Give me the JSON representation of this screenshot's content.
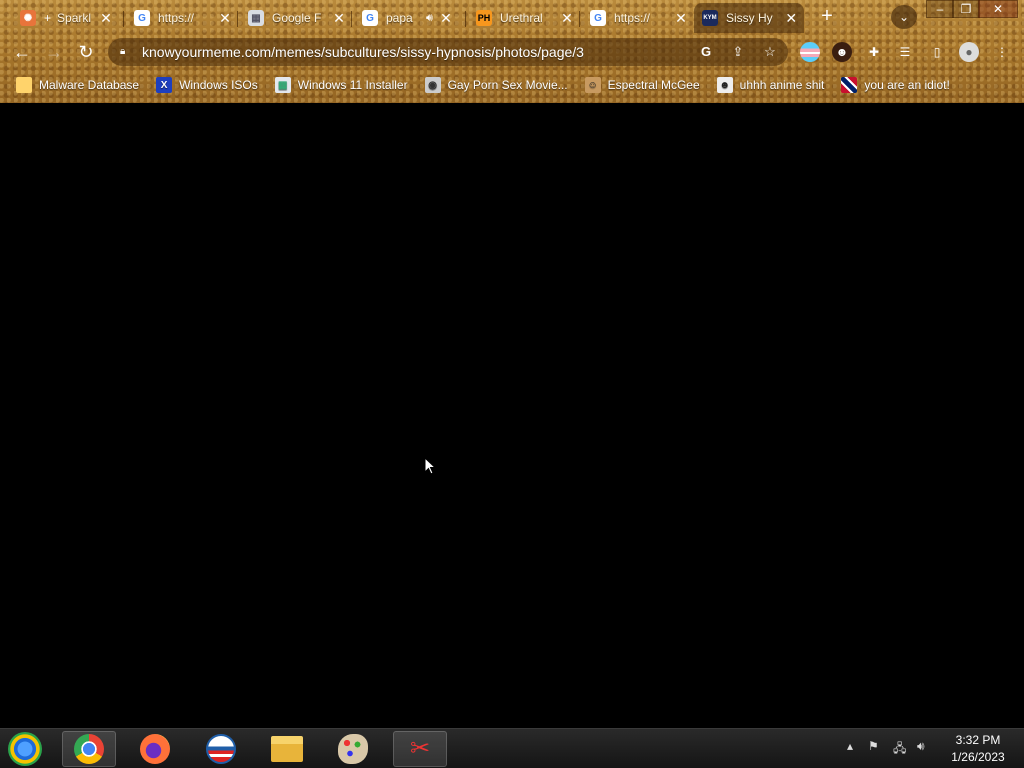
{
  "tabs": [
    {
      "title": "Sparkl",
      "prefix": "+",
      "favicon": "sparkle-icon",
      "active": false
    },
    {
      "title": "https://",
      "favicon": "google-icon",
      "active": false
    },
    {
      "title": "Google F",
      "favicon": "image-icon",
      "active": false
    },
    {
      "title": "papa",
      "favicon": "google-icon",
      "audio": true,
      "active": false
    },
    {
      "title": "Urethral",
      "favicon": "ph-icon",
      "favicon_text": "PH",
      "active": false
    },
    {
      "title": "https://",
      "favicon": "google-icon",
      "active": false
    },
    {
      "title": "Sissy Hy",
      "favicon": "kym-icon",
      "active": true
    }
  ],
  "address_bar": {
    "url": "knowyourmeme.com/memes/subcultures/sissy-hypnosis/photos/page/3"
  },
  "bookmarks": [
    {
      "label": "Malware Database",
      "icon": "folder-icon"
    },
    {
      "label": "Windows ISOs",
      "icon": "x-icon"
    },
    {
      "label": "Windows 11 Installer",
      "icon": "image-icon"
    },
    {
      "label": "Gay Porn Sex Movie...",
      "icon": "globe-icon"
    },
    {
      "label": "Espectral McGee",
      "icon": "face-icon"
    },
    {
      "label": "uhhh anime shit",
      "icon": "anime-icon"
    },
    {
      "label": "you are an idiot!",
      "icon": "flag-icon"
    }
  ],
  "taskbar": {
    "apps": [
      "chrome-icon",
      "firefox-icon",
      "obama-icon",
      "file-explorer-icon",
      "paint-icon",
      "snipping-tool-icon"
    ],
    "time": "3:32 PM",
    "date": "1/26/2023"
  },
  "colors": {
    "frame": "#a8772c",
    "content": "#000000"
  }
}
